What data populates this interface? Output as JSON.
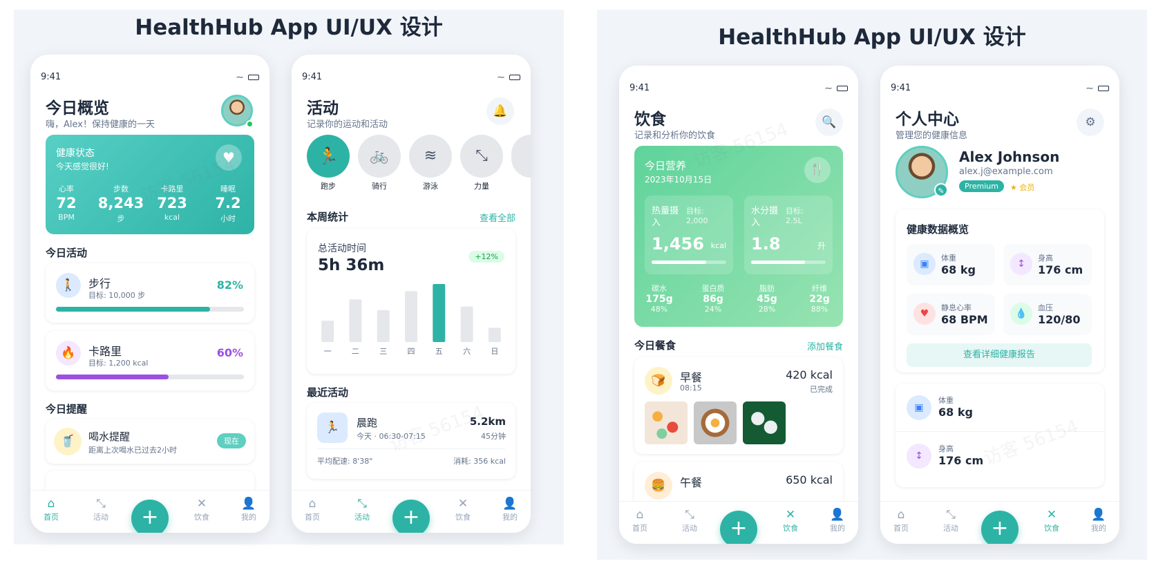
{
  "panel_title": "HealthHub App UI/UX 设计",
  "status_time": "9:41",
  "nav": {
    "home": "首页",
    "activity": "活动",
    "food": "饮食",
    "me": "我的",
    "fab": "+"
  },
  "colors": {
    "accent": "#2db3a5",
    "purple": "#9b51e0",
    "green": "#5fd39b"
  },
  "p1": {
    "title": "今日概览",
    "greeting": "嗨，Alex！保持健康的一天",
    "health": {
      "title": "健康状态",
      "subtitle": "今天感觉很好!",
      "icon": "heart-icon",
      "stats": [
        {
          "label": "心率",
          "value": "72",
          "unit": "BPM"
        },
        {
          "label": "步数",
          "value": "8,243",
          "unit": "步"
        },
        {
          "label": "卡路里",
          "value": "723",
          "unit": "kcal"
        },
        {
          "label": "睡眠",
          "value": "7.2",
          "unit": "小时"
        }
      ]
    },
    "activity_title": "今日活动",
    "activities": [
      {
        "name": "步行",
        "goal": "目标: 10,000 步",
        "percent": "82%",
        "progress": 0.82,
        "icon": "walk-icon"
      },
      {
        "name": "卡路里",
        "goal": "目标: 1,200 kcal",
        "percent": "60%",
        "progress": 0.6,
        "icon": "flame-icon"
      }
    ],
    "reminder_title": "今日提醒",
    "reminder": {
      "name": "喝水提醒",
      "desc": "距离上次喝水已过去2小时",
      "badge": "现在",
      "icon": "cup-icon"
    }
  },
  "p2": {
    "title": "活动",
    "subtitle": "记录你的运动和活动",
    "types": [
      {
        "label": "跑步",
        "icon": "run-icon"
      },
      {
        "label": "骑行",
        "icon": "bike-icon"
      },
      {
        "label": "游泳",
        "icon": "swim-icon"
      },
      {
        "label": "力量",
        "icon": "dumbbell-icon"
      }
    ],
    "week_title": "本周统计",
    "view_all": "查看全部",
    "total_label": "总活动时间",
    "total_value": "5h 36m",
    "change": "+12%",
    "recent_title": "最近活动",
    "recent": {
      "name": "晨跑",
      "time": "今天 · 06:30-07:15",
      "distance": "5.2km",
      "duration": "45分钟",
      "pace": "平均配速: 8'38\"",
      "burn": "消耗: 356 kcal"
    }
  },
  "chart_data": {
    "type": "bar",
    "categories": [
      "一",
      "二",
      "三",
      "四",
      "五",
      "六",
      "日"
    ],
    "values": [
      3.6,
      7.2,
      5.4,
      8.6,
      9.8,
      6.0,
      2.4
    ],
    "highlight_index": 4,
    "title": "",
    "xlabel": "",
    "ylabel": ""
  },
  "p3": {
    "title": "饮食",
    "subtitle": "记录和分析你的饮食",
    "nutrition": {
      "title": "今日营养",
      "date": "2023年10月15日",
      "icon": "utensils-icon",
      "calorie": {
        "label": "热量摄入",
        "goal_label": "目标:",
        "goal": "2,000",
        "value": "1,456",
        "unit": "kcal",
        "progress": 0.728
      },
      "water": {
        "label": "水分摄入",
        "goal_label": "目标:",
        "goal": "2.5L",
        "value": "1.8",
        "unit": "升",
        "progress": 0.72
      },
      "macros": [
        {
          "label": "碳水",
          "value": "175g",
          "pct": "48%"
        },
        {
          "label": "蛋白质",
          "value": "86g",
          "pct": "24%"
        },
        {
          "label": "脂肪",
          "value": "45g",
          "pct": "28%"
        },
        {
          "label": "纤维",
          "value": "22g",
          "pct": "88%"
        }
      ]
    },
    "meals_title": "今日餐食",
    "add_meal": "添加餐食",
    "breakfast": {
      "name": "早餐",
      "time": "08:15",
      "kcal": "420 kcal",
      "status": "已完成"
    },
    "lunch": {
      "name": "午餐",
      "kcal": "650 kcal"
    }
  },
  "p4": {
    "title": "个人中心",
    "subtitle": "管理您的健康信息",
    "name": "Alex Johnson",
    "email": "alex.j@example.com",
    "badge": "Premium",
    "member": "★ 会员",
    "overview_title": "健康数据概览",
    "metrics": [
      {
        "label": "体重",
        "value": "68 kg",
        "icon": "scale-icon"
      },
      {
        "label": "身高",
        "value": "176 cm",
        "icon": "height-icon"
      },
      {
        "label": "静息心率",
        "value": "68 BPM",
        "icon": "heart-icon"
      },
      {
        "label": "血压",
        "value": "120/80",
        "icon": "drop-icon"
      }
    ],
    "report_button": "查看详细健康报告",
    "list": [
      {
        "label": "体重",
        "value": "68 kg"
      },
      {
        "label": "身高",
        "value": "176 cm"
      }
    ]
  },
  "watermark": "访客 56154"
}
